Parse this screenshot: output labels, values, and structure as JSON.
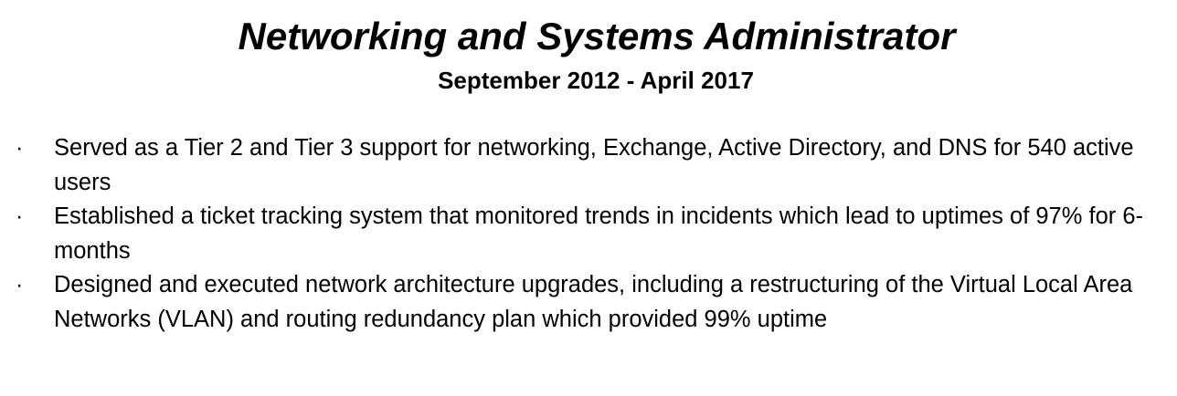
{
  "header": {
    "title": "Networking and Systems Administrator",
    "dates": "September 2012 - April 2017"
  },
  "bullet_symbol": "·",
  "bullets": [
    "Served as a Tier 2 and Tier 3 support for networking, Exchange, Active Directory, and DNS for 540 active users",
    "Established a ticket tracking system that monitored trends in incidents which lead to uptimes of 97% for 6-months",
    "Designed and executed network architecture upgrades, including a restructuring of the Virtual Local Area Networks (VLAN) and routing redundancy plan which provided 99% uptime"
  ]
}
